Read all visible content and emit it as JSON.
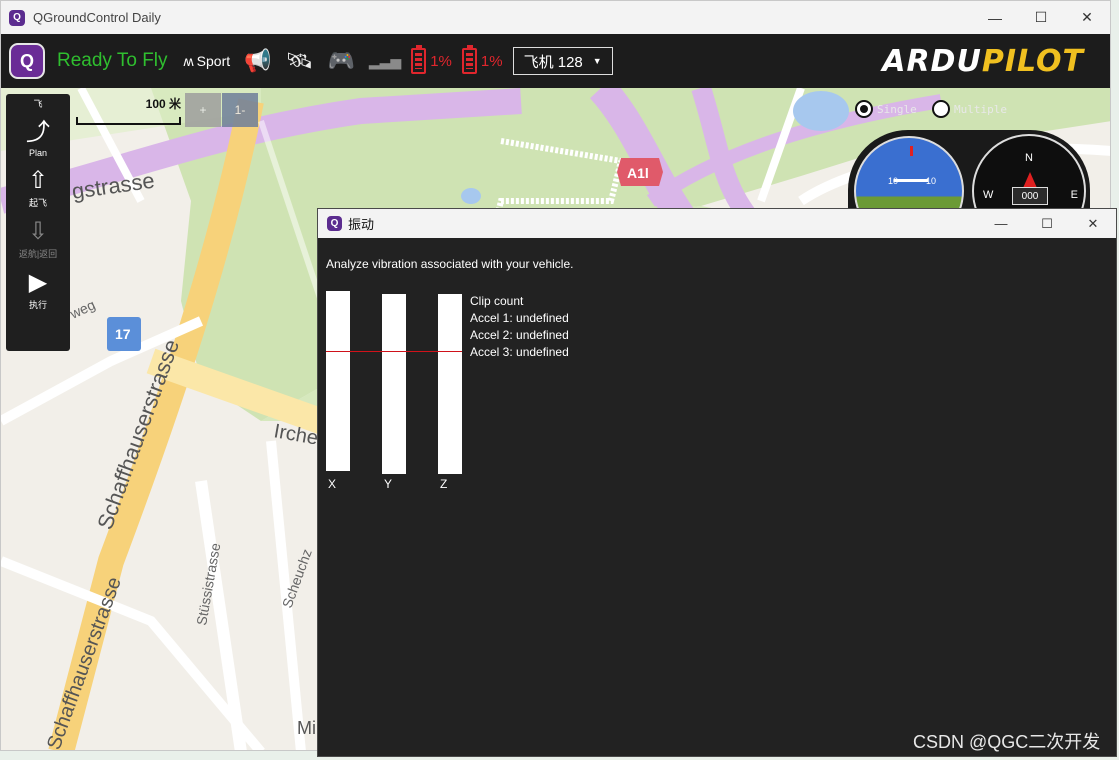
{
  "main_window": {
    "title": "QGroundControl Daily",
    "controls": {
      "minimize": "—",
      "maximize": "☐",
      "close": "✕"
    }
  },
  "toolbar": {
    "status": "Ready To Fly",
    "status_color": "#2fbf2f",
    "flight_mode": "Sport",
    "battery_1": "1%",
    "battery_2": "1%",
    "battery_color": "#e0262d",
    "vehicle_select": "飞机 128",
    "brand_logo": "ARDUPILOT",
    "icons": [
      "qgc-logo-icon",
      "flight-mode-icon",
      "megaphone-icon",
      "gps-satellite-icon",
      "rc-controller-icon",
      "signal-icon",
      "battery-icon",
      "battery-icon",
      "dropdown-arrow-icon"
    ]
  },
  "map": {
    "scale_label": "100 米",
    "zoom_in": "+",
    "zoom_out": "1-",
    "radio_single": "Single",
    "radio_multiple": "Multiple",
    "labels": {
      "street_1": "gstrasse",
      "street_2": "Schaffhauserstrasse",
      "street_3": "Schaffhauserstrasse",
      "street_4": "Irche",
      "street_5": "Stüssistrasse",
      "street_6": "Scheuchz",
      "street_7": "weg",
      "street_8": "Mi",
      "route_shield": "A1l",
      "route_17": "17"
    }
  },
  "tool_strip": {
    "header": "飞",
    "items": [
      {
        "label": "Plan",
        "icon": "plan-route-icon"
      },
      {
        "label": "起飞",
        "icon": "takeoff-icon"
      },
      {
        "label": "返航|返回",
        "icon": "return-icon"
      },
      {
        "label": "执行",
        "icon": "play-icon"
      }
    ]
  },
  "instruments": {
    "attitude_pitch_left": "10",
    "attitude_pitch_right": "10",
    "compass_n": "N",
    "compass_w": "W",
    "compass_e": "E",
    "heading": "000"
  },
  "vibration_window": {
    "title": "振动",
    "controls": {
      "minimize": "—",
      "maximize": "☐",
      "close": "✕"
    },
    "description": "Analyze vibration associated with your vehicle.",
    "axes": [
      "X",
      "Y",
      "Z"
    ],
    "clip_count_title": "Clip count",
    "accel_1": "Accel 1: undefined",
    "accel_2": "Accel 2: undefined",
    "accel_3": "Accel 3: undefined",
    "threshold_color": "#d0121a"
  },
  "watermark": "CSDN @QGC二次开发"
}
